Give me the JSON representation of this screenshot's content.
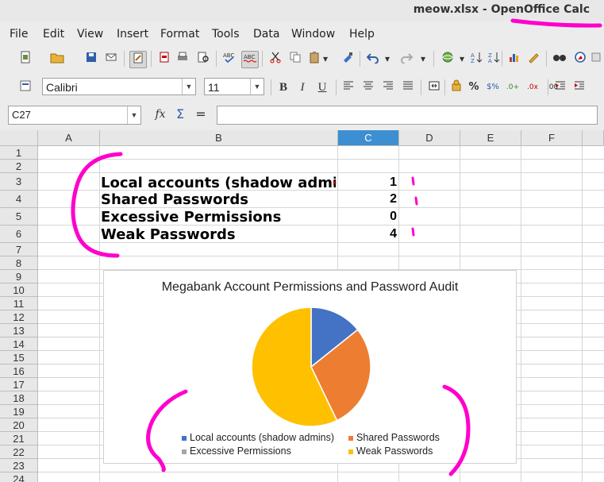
{
  "window": {
    "title": "meow.xlsx - OpenOffice Calc"
  },
  "menu": [
    "File",
    "Edit",
    "View",
    "Insert",
    "Format",
    "Tools",
    "Data",
    "Window",
    "Help"
  ],
  "formatting": {
    "font_name": "Calibri",
    "font_size": "11"
  },
  "formula_bar": {
    "cell_ref": "C27",
    "content": ""
  },
  "columns": [
    "A",
    "B",
    "C",
    "D",
    "E",
    "F"
  ],
  "selected_column": "C",
  "rows": [
    "1",
    "2",
    "3",
    "4",
    "5",
    "6",
    "7",
    "8",
    "9",
    "10",
    "11",
    "12",
    "13",
    "14",
    "15",
    "16",
    "17",
    "18",
    "19",
    "20",
    "21",
    "22",
    "23",
    "24"
  ],
  "cells": [
    {
      "row": "3",
      "label": "Local accounts (shadow admins)",
      "value": "1"
    },
    {
      "row": "4",
      "label": "Shared Passwords",
      "value": "2"
    },
    {
      "row": "5",
      "label": "Excessive Permissions",
      "value": "0"
    },
    {
      "row": "6",
      "label": "Weak Passwords",
      "value": "4"
    }
  ],
  "chart_data": {
    "type": "pie",
    "title": "Megabank Account Permissions and Password Audit",
    "categories": [
      "Local accounts (shadow admins)",
      "Shared Passwords",
      "Excessive Permissions",
      "Weak Passwords"
    ],
    "values": [
      1,
      2,
      0,
      4
    ],
    "colors": [
      "#4472c4",
      "#ed7d31",
      "#a5a5a5",
      "#ffc000"
    ],
    "legend_position": "bottom"
  },
  "colors": {
    "annotation": "#ff00cc",
    "selected_header": "#3d8fd1"
  }
}
